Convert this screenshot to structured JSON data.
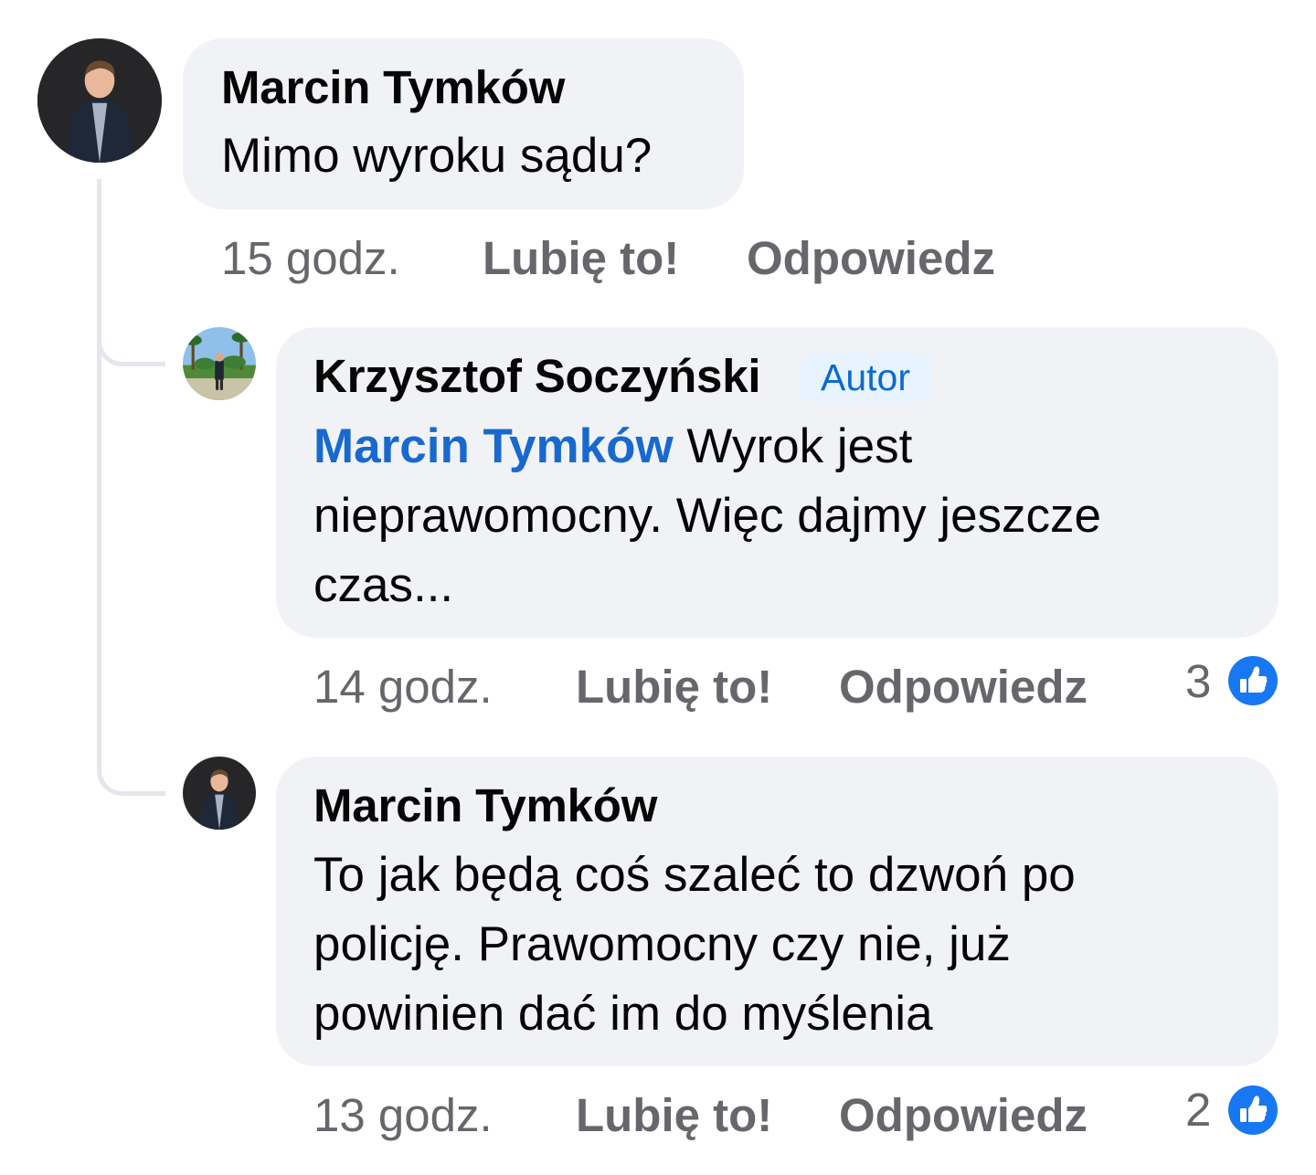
{
  "comments": [
    {
      "author": "Marcin Tymków",
      "text": "Mimo wyroku sądu?",
      "time": "15 godz.",
      "like_label": "Lubię to!",
      "reply_label": "Odpowiedz"
    }
  ],
  "replies": [
    {
      "author": "Krzysztof Soczyński",
      "badge": "Autor",
      "mention": "Marcin Tymków",
      "text_lines": [
        "Wyrok jest",
        "nieprawomocny. Więc dajmy jeszcze",
        "czas..."
      ],
      "time": "14 godz.",
      "like_label": "Lubię to!",
      "reply_label": "Odpowiedz",
      "reaction_count": "3",
      "reaction_icon": "thumbs-up-icon"
    },
    {
      "author": "Marcin Tymków",
      "text_lines": [
        "To jak będą coś szaleć to dzwoń po",
        "policję. Prawomocny czy nie, już",
        "powinien dać im do myślenia"
      ],
      "time": "13 godz.",
      "like_label": "Lubię to!",
      "reply_label": "Odpowiedz",
      "reaction_count": "2",
      "reaction_icon": "thumbs-up-icon"
    }
  ],
  "colors": {
    "bubble": "#f0f2f5",
    "mention": "#1869cf",
    "meta": "#65676b",
    "badge_bg": "#e7f3ff",
    "badge_text": "#0a6bcf",
    "like_blue": "#1877f2",
    "thread_line": "#e4e6eb"
  }
}
